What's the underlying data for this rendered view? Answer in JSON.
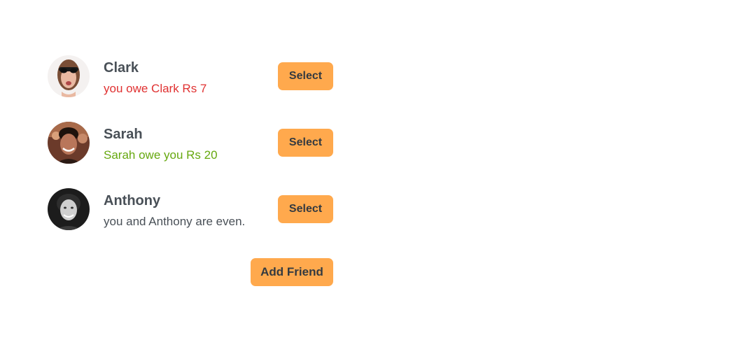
{
  "friends": [
    {
      "name": "Clark",
      "balance_text": "you owe Clark Rs 7",
      "status": "red",
      "select_label": "Select"
    },
    {
      "name": "Sarah",
      "balance_text": "Sarah owe you Rs 20",
      "status": "green",
      "select_label": "Select"
    },
    {
      "name": "Anthony",
      "balance_text": "you and Anthony are even.",
      "status": "even",
      "select_label": "Select"
    }
  ],
  "add_friend_label": "Add Friend",
  "colors": {
    "button": "#ffa94d",
    "owe_red": "#e03131",
    "owed_green": "#66a80f",
    "text": "#495057"
  }
}
